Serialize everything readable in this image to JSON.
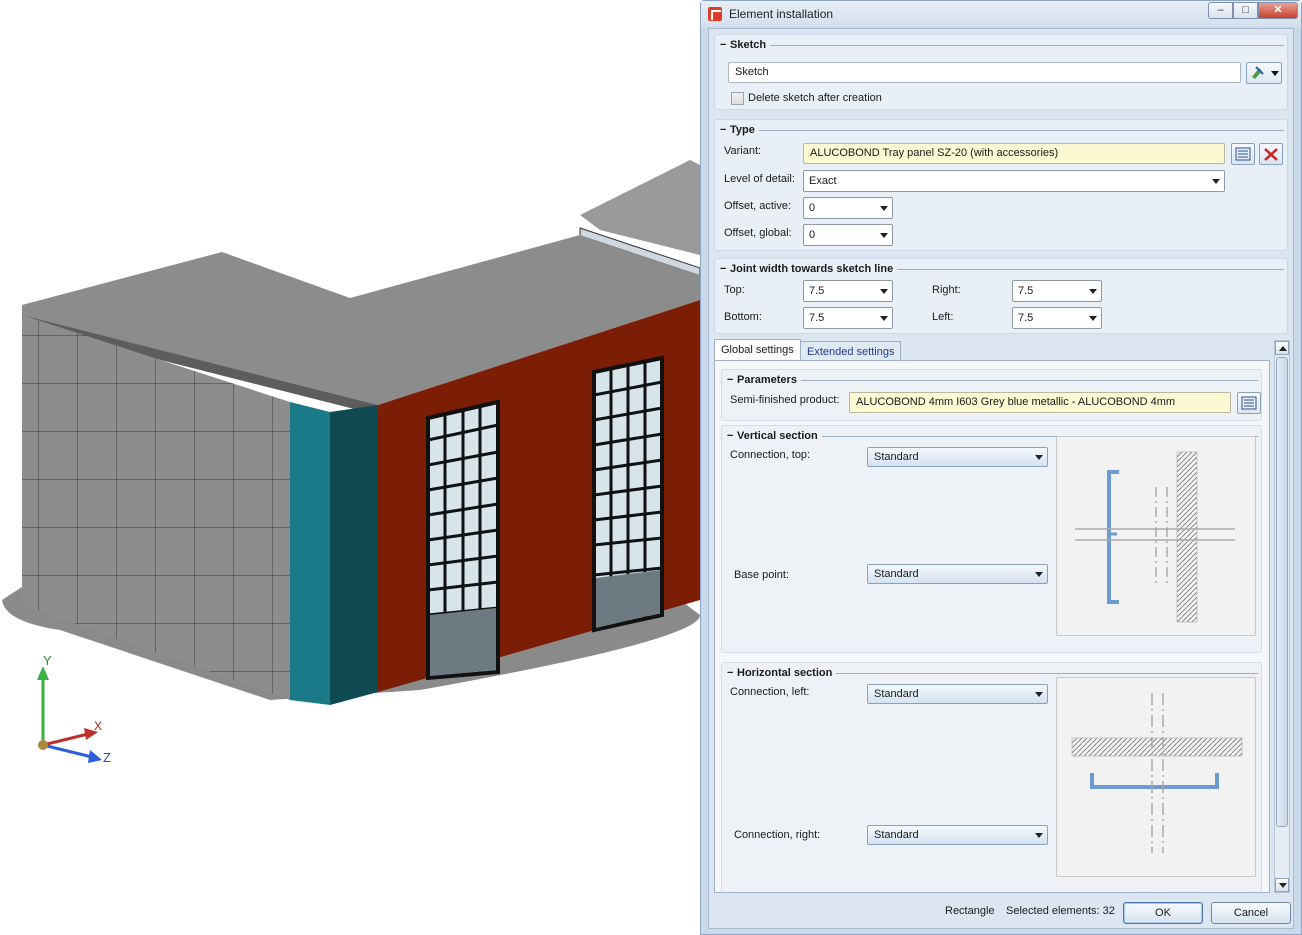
{
  "viewport": {
    "axes": {
      "y": "Y",
      "x": "X",
      "z": "Z"
    }
  },
  "dialog": {
    "title": "Element installation",
    "window_buttons": {
      "minimize": "–",
      "maximize": "□",
      "close": "✕"
    },
    "sketch": {
      "title": "Sketch",
      "input_value": "Sketch",
      "delete_checkbox_label": "Delete sketch after creation",
      "delete_checked": false
    },
    "type": {
      "title": "Type",
      "variant_label": "Variant:",
      "variant_value": "ALUCOBOND Tray panel SZ-20 (with accessories)",
      "level_label": "Level of detail:",
      "level_value": "Exact",
      "offset_active_label": "Offset, active:",
      "offset_active_value": "0",
      "offset_global_label": "Offset, global:",
      "offset_global_value": "0"
    },
    "joint": {
      "title": "Joint width towards sketch line",
      "top_label": "Top:",
      "top_value": "7.5",
      "bottom_label": "Bottom:",
      "bottom_value": "7.5",
      "right_label": "Right:",
      "right_value": "7.5",
      "left_label": "Left:",
      "left_value": "7.5"
    },
    "tabs": [
      "Global settings",
      "Extended settings"
    ],
    "parameters": {
      "title": "Parameters",
      "semi_label": "Semi-finished product:",
      "semi_value": "ALUCOBOND 4mm I603 Grey blue metallic - ALUCOBOND 4mm"
    },
    "vertical": {
      "title": "Vertical section",
      "conn_top_label": "Connection, top:",
      "conn_top_value": "Standard",
      "base_label": "Base point:",
      "base_value": "Standard"
    },
    "horizontal": {
      "title": "Horizontal section",
      "conn_left_label": "Connection, left:",
      "conn_left_value": "Standard",
      "conn_right_label": "Connection, right:",
      "conn_right_value": "Standard"
    },
    "footer": {
      "mode": "Rectangle",
      "selected": "Selected elements: 32",
      "ok": "OK",
      "cancel": "Cancel"
    },
    "colors": {
      "panel_cyan": "#1b7a87",
      "panel_red": "#7b1e05",
      "profile_blue": "#6d9bd1"
    }
  }
}
